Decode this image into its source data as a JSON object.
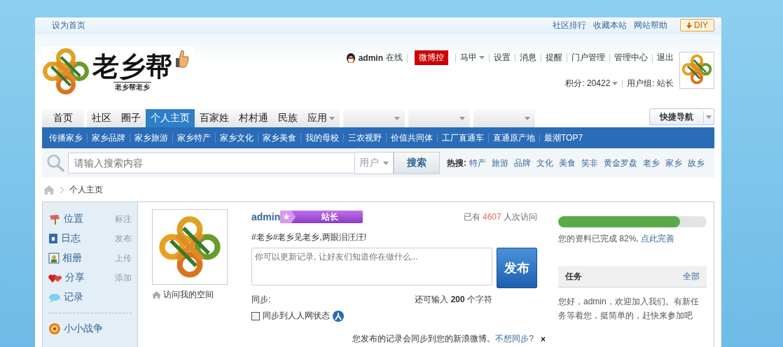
{
  "top_bar": {
    "left_link": "设为首页",
    "links": [
      "社区排行",
      "收藏本站",
      "网站帮助"
    ],
    "diy_button": "DIY"
  },
  "header": {
    "logo_title": "老乡帮",
    "logo_subtitle": "老乡帮老乡",
    "user_bar": {
      "username": "admin",
      "status": "在线",
      "weibo_button": "微博控",
      "links": [
        {
          "label": "马甲",
          "has_menu": true
        },
        {
          "label": "设置",
          "has_menu": false
        },
        {
          "label": "消息",
          "has_menu": false
        },
        {
          "label": "提醒",
          "has_menu": false
        },
        {
          "label": "门户管理",
          "has_menu": false
        },
        {
          "label": "管理中心",
          "has_menu": false
        },
        {
          "label": "退出",
          "has_menu": false
        }
      ],
      "points": "积分: 20422",
      "user_group": "用户组: 站长"
    }
  },
  "nav": {
    "tabs": [
      {
        "kind": "text",
        "label": "首页",
        "selected": false,
        "has_menu": false
      },
      {
        "kind": "text",
        "label": "社区",
        "selected": false,
        "has_menu": false
      },
      {
        "kind": "text",
        "label": "圈子",
        "selected": false,
        "has_menu": false
      },
      {
        "kind": "text",
        "label": "个人主页",
        "selected": true,
        "has_menu": false
      },
      {
        "kind": "text",
        "label": "百家姓",
        "selected": false,
        "has_menu": false
      },
      {
        "kind": "text",
        "label": "村村通",
        "selected": false,
        "has_menu": false
      },
      {
        "kind": "text",
        "label": "民族",
        "selected": false,
        "has_menu": false
      },
      {
        "kind": "text",
        "label": "应用",
        "selected": false,
        "has_menu": true
      },
      {
        "kind": "blank",
        "selected": false,
        "has_menu": true
      },
      {
        "kind": "blank",
        "selected": false,
        "has_menu": true
      },
      {
        "kind": "blank",
        "selected": false,
        "has_menu": true
      }
    ],
    "quick_nav": "快捷导航"
  },
  "subnav": [
    "传播家乡",
    "家乡品牌",
    "家乡旅游",
    "家乡特产",
    "家乡文化",
    "家乡美食",
    "我的母校",
    "三农视野",
    "价值共同体",
    "工厂直通车",
    "直通原产地",
    "最潮TOP7"
  ],
  "search": {
    "placeholder": "请输入搜索内容",
    "scope": "用户",
    "button": "搜索",
    "hot_label": "热搜:",
    "hot_words": [
      "特产",
      "旅游",
      "品牌",
      "文化",
      "美食",
      "笑非",
      "黄金罗盘",
      "老乡",
      "家乡",
      "故乡"
    ]
  },
  "breadcrumb": {
    "current": "个人主页"
  },
  "sidebar": {
    "apps": [
      {
        "kind": "flag",
        "label": "位置",
        "action": "标注"
      },
      {
        "kind": "book",
        "label": "日志",
        "action": "发布"
      },
      {
        "kind": "photo",
        "label": "相册",
        "action": "上传"
      },
      {
        "kind": "heart",
        "label": "分享",
        "action": "添加"
      },
      {
        "kind": "bubble",
        "label": "记录"
      }
    ],
    "games": [
      {
        "kind": "target",
        "label": "小小战争"
      }
    ]
  },
  "profile": {
    "visit_link": "访问我的空间",
    "name": "admin",
    "badge": "站长",
    "visits": {
      "prefix": "已有",
      "count": "4607",
      "suffix": "人次访问"
    },
    "status_text": "#老乡#老乡见老乡,两眼泪汪汪!",
    "composer_placeholder": "你可以更新记录, 让好友们知道你在做什么...",
    "publish_button": "发布",
    "sync_label": "同步:",
    "char_count": "还可输入 **200** 个字符",
    "sync_option": {
      "label": "同步到人人网状态",
      "checked": false
    },
    "notice": {
      "text": "您发布的记录会同步到您的新浪微博。",
      "link": "不想同步?",
      "close": "×"
    }
  },
  "completion": {
    "level": 0.82,
    "text": "您的资料已完成 82%,",
    "link": "点此完善"
  },
  "tasks": {
    "title": "任务",
    "all_link": "全部",
    "text": "您好，admin，欢迎加入我们。有新任务等着您，挺简单的，赶快来参加吧"
  }
}
